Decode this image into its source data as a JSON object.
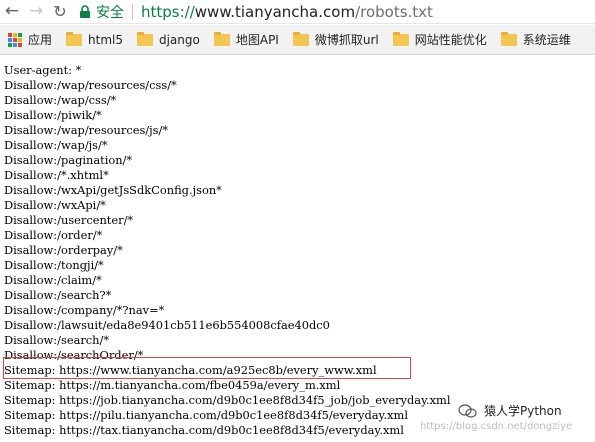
{
  "browser": {
    "secure_label": "安全",
    "url_scheme": "https://",
    "url_host": "www.tianyancha.com",
    "url_path": "/robots.txt"
  },
  "bookmarks": {
    "apps_label": "应用",
    "items": [
      "html5",
      "django",
      "地图API",
      "微博抓取url",
      "网站性能优化",
      "系统运维"
    ]
  },
  "robots": {
    "lines": [
      "User-agent: *",
      "Disallow:/wap/resources/css/*",
      "Disallow:/wap/css/*",
      "Disallow:/piwik/*",
      "Disallow:/wap/resources/js/*",
      "Disallow:/wap/js/*",
      "Disallow:/pagination/*",
      "Disallow:/*.xhtml*",
      "Disallow:/wxApi/getJsSdkConfig.json*",
      "Disallow:/wxApi/*",
      "Disallow:/usercenter/*",
      "Disallow:/order/*",
      "Disallow:/orderpay/*",
      "Disallow:/tongji/*",
      "Disallow:/claim/*",
      "Disallow:/search?*",
      "Disallow:/company/*?nav=*",
      "Disallow:/lawsuit/eda8e9401cb511e6b554008cfae40dc0",
      "Disallow:/search/*",
      "Disallow:/searchOrder/*",
      "Sitemap: https://www.tianyancha.com/a925ec8b/every_www.xml",
      "Sitemap: https://m.tianyancha.com/fbe0459a/every_m.xml",
      "Sitemap: https://job.tianyancha.com/d9b0c1ee8f8d34f5_job/job_everyday.xml",
      "Sitemap: https://pilu.tianyancha.com/d9b0c1ee8f8d34f5/everyday.xml",
      "Sitemap: https://tax.tianyancha.com/d9b0c1ee8f8d34f5/everyday.xml"
    ]
  },
  "watermark": {
    "label": "猿人学Python",
    "subtext": "https://blog.csdn.net/dongziye"
  },
  "colors": {
    "secure_green": "#0b8043",
    "highlight_red": "#d84a4a",
    "folder_yellow": "#f3c651"
  }
}
